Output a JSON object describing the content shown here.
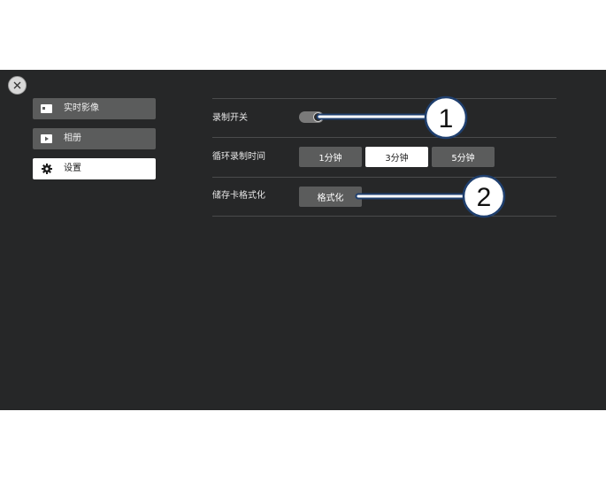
{
  "sidebar": {
    "items": [
      {
        "label": "实时影像",
        "icon": "camera-icon"
      },
      {
        "label": "相册",
        "icon": "play-icon"
      },
      {
        "label": "设置",
        "icon": "gear-icon",
        "active": true
      }
    ]
  },
  "settings": {
    "record_switch": {
      "label": "录制开关",
      "on": true
    },
    "loop_duration": {
      "label": "循环录制时间",
      "options": [
        "1分钟",
        "3分钟",
        "5分钟"
      ],
      "selected": "3分钟"
    },
    "format_card": {
      "label": "储存卡格式化",
      "button_label": "格式化"
    }
  },
  "callouts": [
    "1",
    "2"
  ],
  "colors": {
    "panel_bg": "#262728",
    "button_bg": "#5b5c5c",
    "selected_bg": "#ffffff",
    "callout": "#1f3f6e"
  }
}
